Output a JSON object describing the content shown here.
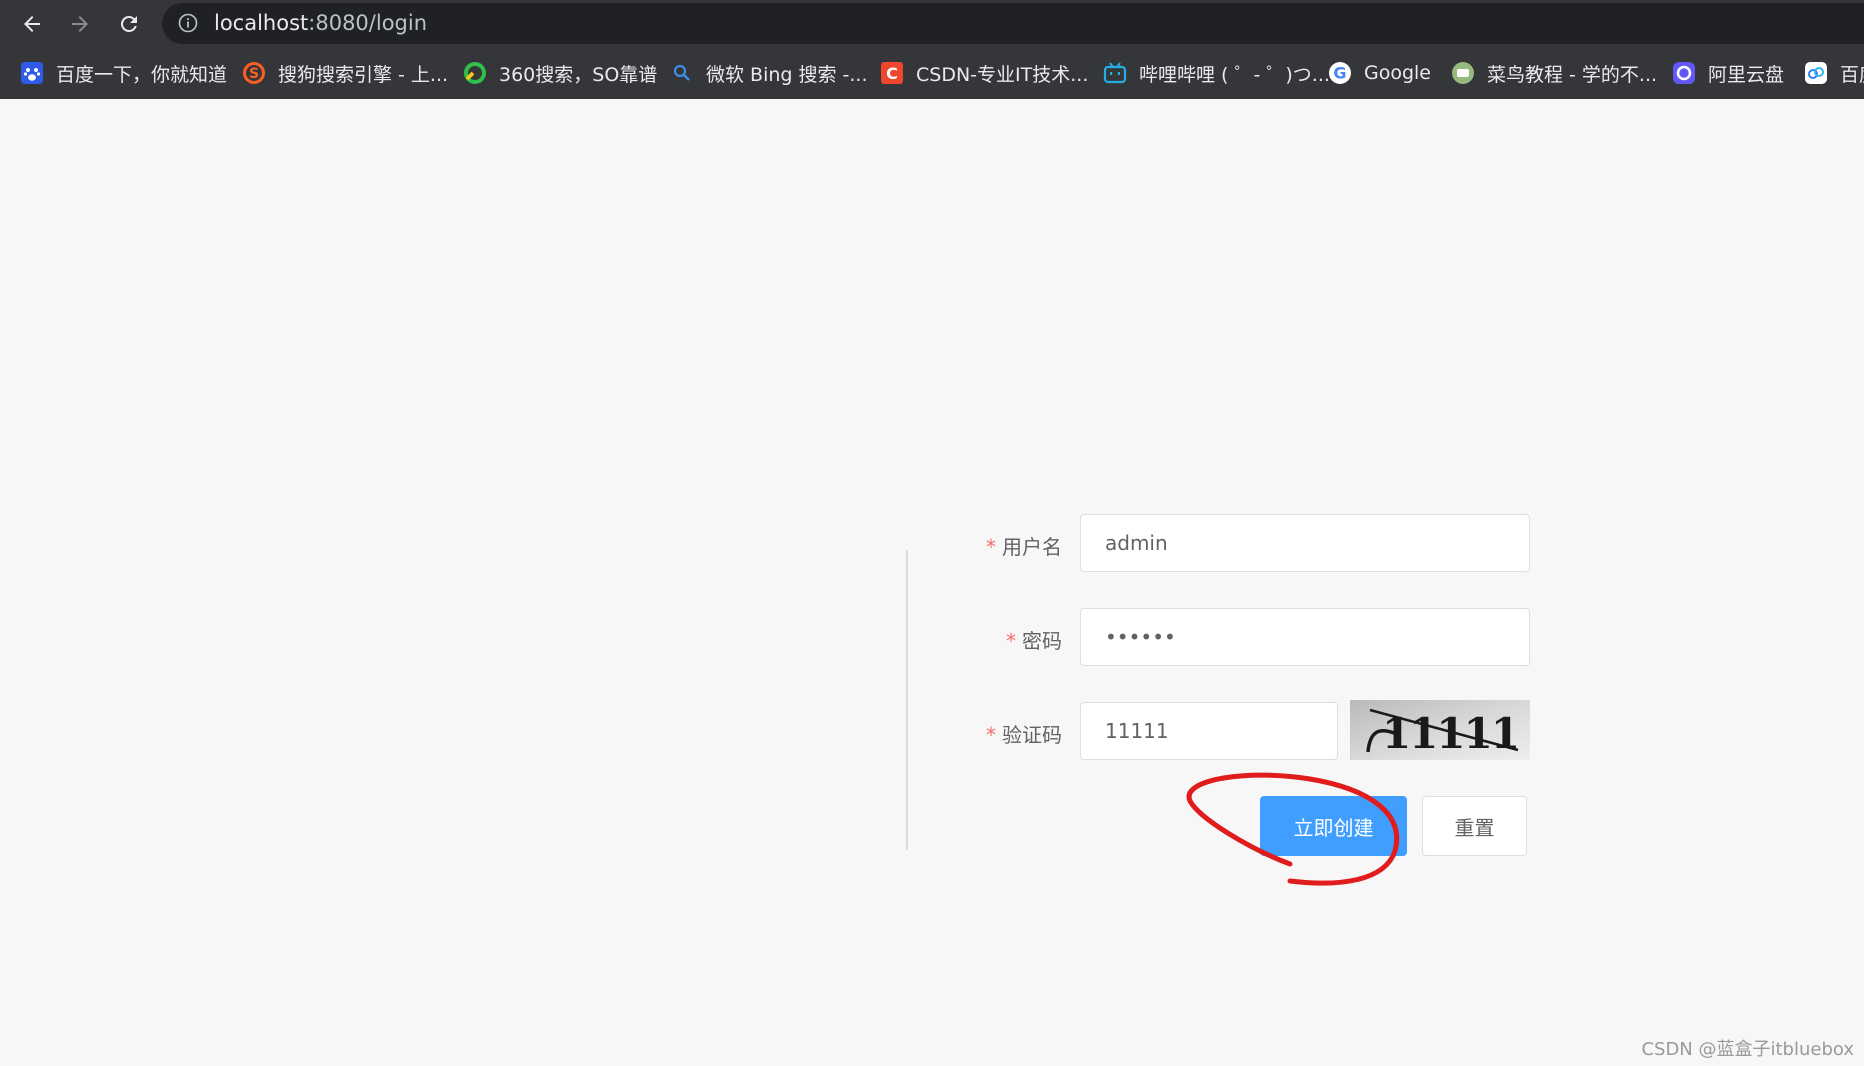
{
  "browser": {
    "url_host": "localhost",
    "url_rest": ":8080/login",
    "bookmarks": [
      {
        "label": "百度一下，你就知道",
        "icon": "baidu-icon"
      },
      {
        "label": "搜狗搜索引擎 - 上...",
        "icon": "sogou-icon"
      },
      {
        "label": "360搜索，SO靠谱",
        "icon": "360-icon"
      },
      {
        "label": "微软 Bing 搜索 -...",
        "icon": "bing-search-icon"
      },
      {
        "label": "CSDN-专业IT技术...",
        "icon": "csdn-icon"
      },
      {
        "label": "哔哩哔哩 ( ゜- ゜)つ...",
        "icon": "bilibili-icon"
      },
      {
        "label": "Google",
        "icon": "google-icon"
      },
      {
        "label": "菜鸟教程 - 学的不...",
        "icon": "runoob-icon"
      },
      {
        "label": "阿里云盘",
        "icon": "aliyun-drive-icon"
      },
      {
        "label": "百度",
        "icon": "baidu-netdisk-icon"
      }
    ]
  },
  "form": {
    "username_label": "用户名",
    "password_label": "密码",
    "captcha_label": "验证码",
    "required_mark": "*",
    "username_value": "admin",
    "password_value": "••••••",
    "captcha_value": "11111",
    "captcha_image_text": "11111",
    "create_button": "立即创建",
    "reset_button": "重置"
  },
  "watermark": "CSDN @蓝盒子itbluebox",
  "colors": {
    "primary": "#409eff",
    "required": "#f56c6c",
    "annotation": "#e01c1c",
    "chrome_bg": "#35363a"
  }
}
